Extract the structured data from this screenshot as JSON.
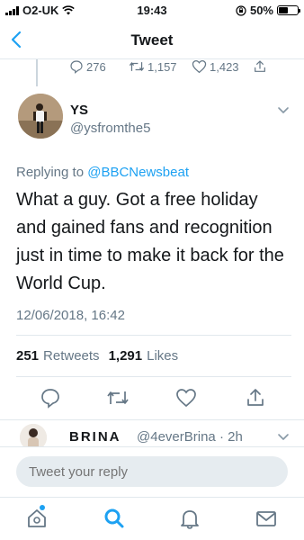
{
  "status_bar": {
    "carrier": "O2-UK",
    "time": "19:43",
    "battery": "50%",
    "battery_level": 0.5
  },
  "nav": {
    "title": "Tweet",
    "back_icon": "chevron-left-icon"
  },
  "previous_tweet_actions": {
    "replies": "276",
    "retweets": "1,157",
    "likes": "1,423"
  },
  "tweet": {
    "author_name": "YS",
    "author_handle": "@ysfromthe5",
    "replying_prefix": "Replying to",
    "replying_to": "@BBCNewsbeat",
    "text": "What a guy. Got a free holiday and gained fans and recognition just in time to make it back for the World Cup.",
    "date": "12/06/2018, 16:42",
    "retweet_count": "251",
    "retweet_label": "Retweets",
    "like_count": "1,291",
    "like_label": "Likes"
  },
  "reply_preview": {
    "name": "BRINA",
    "handle": "@4everBrina",
    "separator": "·",
    "age": "2h"
  },
  "compose": {
    "placeholder": "Tweet your reply"
  },
  "tab_bar": {
    "items": [
      "home-icon",
      "search-icon",
      "notifications-icon",
      "messages-icon"
    ],
    "active": "search-icon"
  },
  "colors": {
    "accent": "#1da1f2",
    "text": "#14171a",
    "muted": "#657786",
    "border": "#e1e8ed"
  }
}
